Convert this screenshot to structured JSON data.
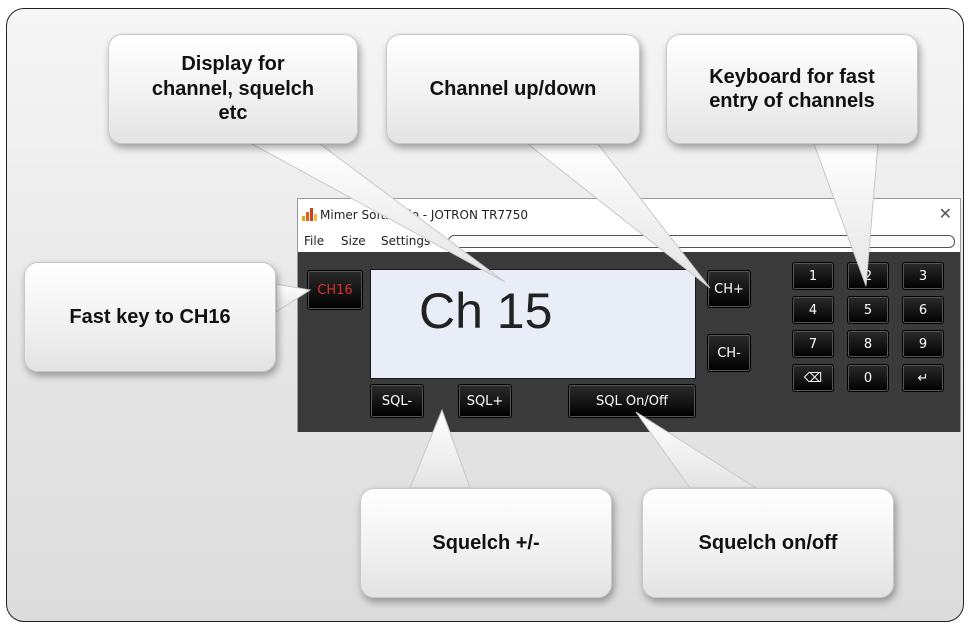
{
  "callouts": {
    "display": "Display for\nchannel, squelch\netc",
    "channel_updown": "Channel up/down",
    "keyboard": "Keyboard for fast\nentry of channels",
    "fast_key": "Fast key to CH16",
    "squelch_pm": "Squelch +/-",
    "squelch_onoff": "Squelch on/off"
  },
  "app": {
    "title": "Mimer SoftRadio - JOTRON TR7750",
    "close_glyph": "✕",
    "menu": [
      "File",
      "Size",
      "Settings"
    ],
    "display_text": "Ch 15",
    "buttons": {
      "ch16": "CH16",
      "ch_plus": "CH+",
      "ch_minus": "CH-",
      "sql_minus": "SQL-",
      "sql_plus": "SQL+",
      "sql_onoff": "SQL On/Off"
    },
    "keypad": [
      "1",
      "2",
      "3",
      "4",
      "5",
      "6",
      "7",
      "8",
      "9",
      "⌫",
      "0",
      "↵"
    ]
  },
  "colors": {
    "panel": "#3a3a3a",
    "display_bg": "#e8edf8",
    "ch16_text": "#e03030",
    "icon_bars": [
      "#e8a020",
      "#e06010",
      "#d04020",
      "#f0c040"
    ]
  }
}
